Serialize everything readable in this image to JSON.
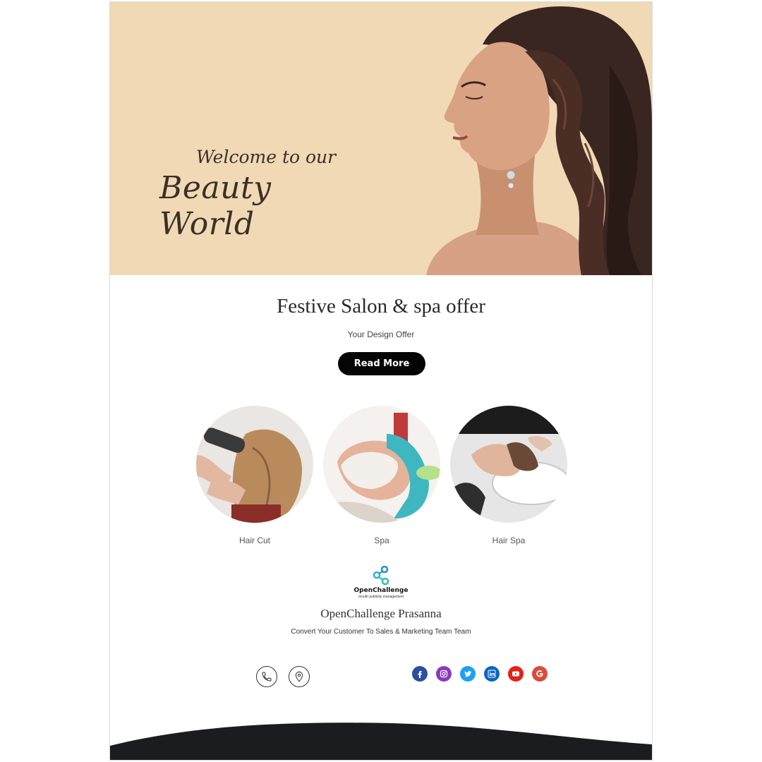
{
  "hero": {
    "welcome": "Welcome to our",
    "headline": "Beauty World"
  },
  "offer": {
    "title": "Festive Salon & spa offer",
    "subtitle": "Your Design Offer",
    "button_label": "Read More"
  },
  "services": [
    {
      "label": "Hair Cut",
      "icon": "hair-cut-photo"
    },
    {
      "label": "Spa",
      "icon": "spa-facial-photo"
    },
    {
      "label": "Hair Spa",
      "icon": "hair-wash-photo"
    }
  ],
  "brand": {
    "logo_name": "OpenChallenge",
    "logo_tagline": "mouth publicity management",
    "company": "OpenChallenge Prasanna",
    "tagline": "Convert Your Customer To Sales & Marketing Team Team"
  },
  "contact": [
    {
      "icon": "phone-icon"
    },
    {
      "icon": "location-pin-icon"
    }
  ],
  "social": [
    {
      "icon": "facebook-icon",
      "color": "#2d4f9e"
    },
    {
      "icon": "instagram-icon",
      "color": "#8a3ab9"
    },
    {
      "icon": "twitter-icon",
      "color": "#1da1f2"
    },
    {
      "icon": "linkedin-icon",
      "color": "#0a66c2"
    },
    {
      "icon": "youtube-icon",
      "color": "#e62117"
    },
    {
      "icon": "google-icon",
      "color": "#dd4b39"
    }
  ],
  "colors": {
    "hero_bg": "#f1d9b5",
    "button_bg": "#050505",
    "footer": "#1b1c20"
  }
}
